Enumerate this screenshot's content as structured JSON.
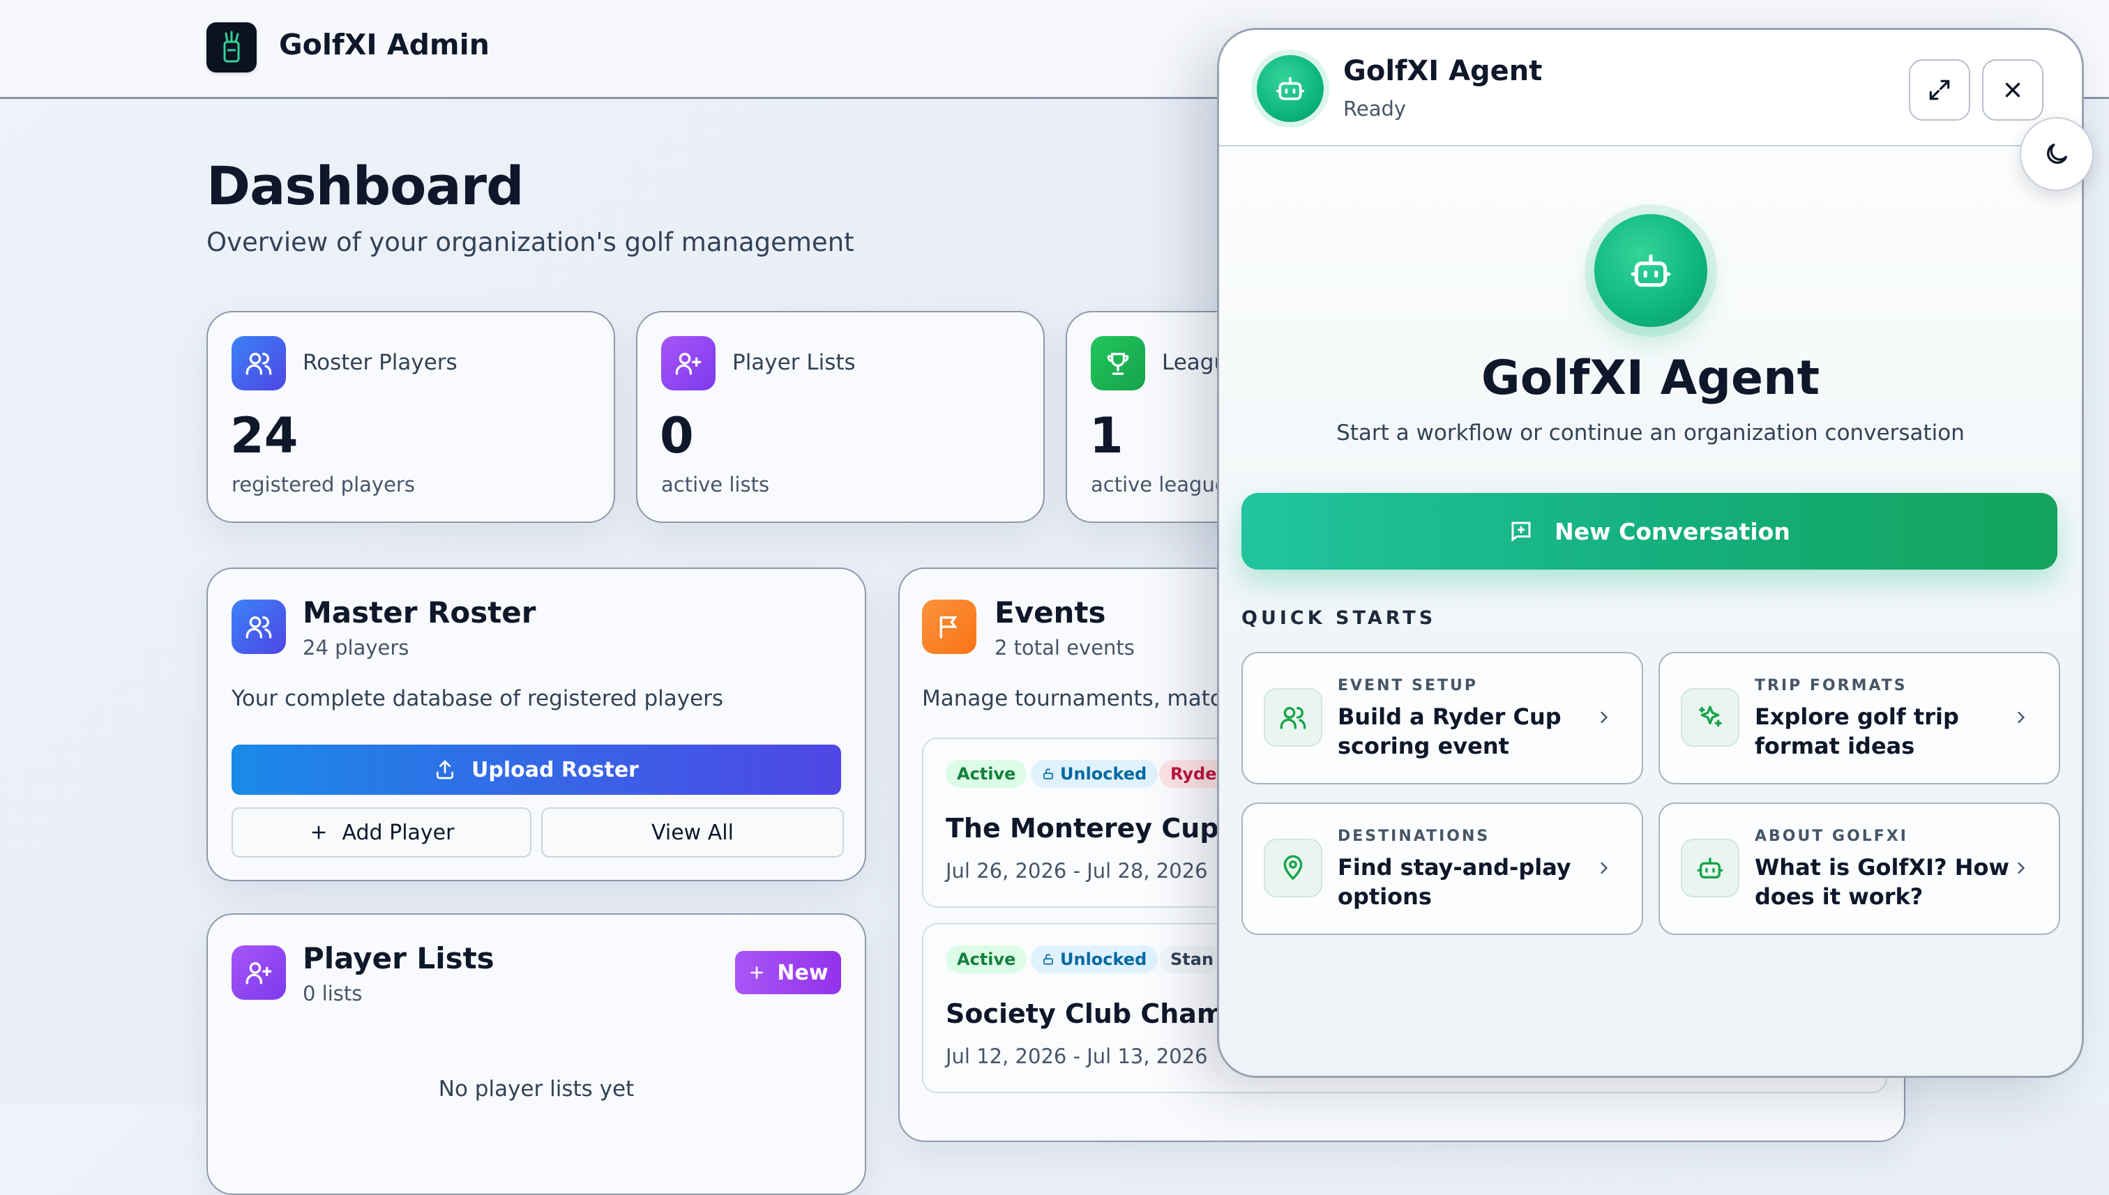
{
  "header": {
    "app_title": "GolfXI Admin"
  },
  "page": {
    "title": "Dashboard",
    "subtitle": "Overview of your organization's golf management"
  },
  "stats": [
    {
      "label": "Roster Players",
      "value": "24",
      "caption": "registered players",
      "icon": "users-icon",
      "color": "#2563eb"
    },
    {
      "label": "Player Lists",
      "value": "0",
      "caption": "active lists",
      "icon": "user-plus-icon",
      "color": "#9333ea"
    },
    {
      "label": "Leagues",
      "value": "1",
      "caption": "active leagues",
      "icon": "trophy-icon",
      "color": "#16a34a"
    }
  ],
  "master_roster": {
    "title": "Master Roster",
    "subtitle": "24 players",
    "description": "Your complete database of registered players",
    "upload_label": "Upload Roster",
    "add_label": "Add Player",
    "view_all_label": "View All"
  },
  "events": {
    "title": "Events",
    "subtitle": "2 total events",
    "description": "Manage tournaments, matches",
    "items": [
      {
        "tags": [
          "Active",
          "Unlocked",
          "Ryder Cup"
        ],
        "title": "The Monterey Cup",
        "dates": "Jul 26, 2026 - Jul 28, 2026"
      },
      {
        "tags": [
          "Active",
          "Unlocked",
          "Stan"
        ],
        "title": "Society Club Championship",
        "dates": "Jul 12, 2026 - Jul 13, 2026"
      }
    ]
  },
  "player_lists": {
    "title": "Player Lists",
    "subtitle": "0 lists",
    "new_label": "New",
    "empty_text": "No player lists yet"
  },
  "agent": {
    "name": "GolfXI Agent",
    "status": "Ready",
    "hero_title": "GolfXI Agent",
    "hero_subtitle": "Start a workflow or continue an organization conversation",
    "new_conversation_label": "New Conversation",
    "quick_starts_label": "QUICK STARTS",
    "quick_starts": [
      {
        "category": "EVENT SETUP",
        "title": "Build a Ryder Cup scoring event",
        "icon": "users-icon"
      },
      {
        "category": "TRIP FORMATS",
        "title": "Explore golf trip format ideas",
        "icon": "sparkles-icon"
      },
      {
        "category": "DESTINATIONS",
        "title": "Find stay-and-play options",
        "icon": "map-pin-icon"
      },
      {
        "category": "ABOUT GOLFXI",
        "title": "What is GolfXI? How does it work?",
        "icon": "bot-icon"
      }
    ]
  },
  "colors": {
    "accent_green": "#10b981",
    "accent_blue": "#2563eb",
    "accent_purple": "#9333ea",
    "accent_orange": "#f97316"
  }
}
